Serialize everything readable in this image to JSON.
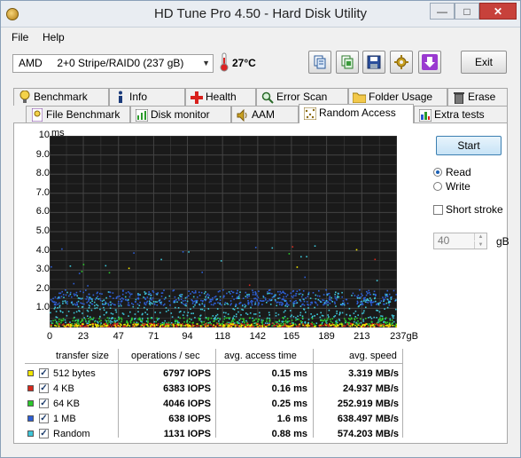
{
  "window": {
    "title": "HD Tune Pro 4.50 - Hard Disk Utility",
    "min_glyph": "—",
    "max_glyph": "□",
    "close_glyph": "✕"
  },
  "menu": {
    "file": "File",
    "help": "Help"
  },
  "toolbar": {
    "drive": "AMD     2+0 Stripe/RAID0 (237 gB)",
    "temperature": "27°C",
    "exit_label": "Exit",
    "icons": [
      "copy-info-icon",
      "copy-screen-icon",
      "save-icon",
      "options-icon",
      "download-icon"
    ]
  },
  "tabs_top": [
    {
      "label": "Benchmark",
      "icon": "lightbulb-icon"
    },
    {
      "label": "Info",
      "icon": "info-icon"
    },
    {
      "label": "Health",
      "icon": "health-cross-icon"
    },
    {
      "label": "Error Scan",
      "icon": "magnifier-icon"
    },
    {
      "label": "Folder Usage",
      "icon": "folder-icon"
    },
    {
      "label": "Erase",
      "icon": "trash-icon"
    }
  ],
  "tabs_bottom": [
    {
      "label": "File Benchmark",
      "icon": "file-benchmark-icon"
    },
    {
      "label": "Disk monitor",
      "icon": "disk-monitor-icon"
    },
    {
      "label": "AAM",
      "icon": "speaker-icon"
    },
    {
      "label": "Random Access",
      "icon": "random-access-icon",
      "active": true
    },
    {
      "label": "Extra tests",
      "icon": "extra-tests-icon"
    }
  ],
  "controls": {
    "start_label": "Start",
    "read_label": "Read",
    "write_label": "Write",
    "read_selected": true,
    "short_stroke_label": "Short stroke",
    "short_stroke_checked": false,
    "stroke_value": "40",
    "stroke_unit": "gB"
  },
  "chart_data": {
    "type": "scatter",
    "ylabel": "ms",
    "y_ticks": [
      "10",
      "9.0",
      "8.0",
      "7.0",
      "6.0",
      "5.0",
      "4.0",
      "3.0",
      "2.0",
      "1.0"
    ],
    "x_ticks": [
      "0",
      "23",
      "47",
      "71",
      "94",
      "118",
      "142",
      "165",
      "189",
      "213",
      "237gB"
    ],
    "xlim": [
      0,
      237
    ],
    "ylim": [
      0,
      10
    ],
    "grid": true,
    "background": "#1a1a1a",
    "grid_color": "#444444",
    "series": [
      {
        "name": "512 bytes",
        "color": "#f2e600",
        "access_ms_mean": 0.15
      },
      {
        "name": "4 KB",
        "color": "#d8281c",
        "access_ms_mean": 0.16
      },
      {
        "name": "64 KB",
        "color": "#2cc92c",
        "access_ms_mean": 0.25
      },
      {
        "name": "1 MB",
        "color": "#2d5fd6",
        "access_ms_mean": 1.6
      },
      {
        "name": "Random",
        "color": "#3ec6d8",
        "access_ms_mean": 0.88
      }
    ]
  },
  "table": {
    "headers": {
      "size": "transfer size",
      "ops": "operations / sec",
      "access": "avg. access time",
      "speed": "avg. speed"
    },
    "rows": [
      {
        "color": "#f2e600",
        "label": "512 bytes",
        "ops": "6797 IOPS",
        "access": "0.15 ms",
        "speed": "3.319 MB/s"
      },
      {
        "color": "#d8281c",
        "label": "4 KB",
        "ops": "6383 IOPS",
        "access": "0.16 ms",
        "speed": "24.937 MB/s"
      },
      {
        "color": "#2cc92c",
        "label": "64 KB",
        "ops": "4046 IOPS",
        "access": "0.25 ms",
        "speed": "252.919 MB/s"
      },
      {
        "color": "#2d5fd6",
        "label": "1 MB",
        "ops": "638 IOPS",
        "access": "1.6 ms",
        "speed": "638.497 MB/s"
      },
      {
        "color": "#3ec6d8",
        "label": "Random",
        "ops": "1131 IOPS",
        "access": "0.88 ms",
        "speed": "574.203 MB/s"
      }
    ]
  }
}
